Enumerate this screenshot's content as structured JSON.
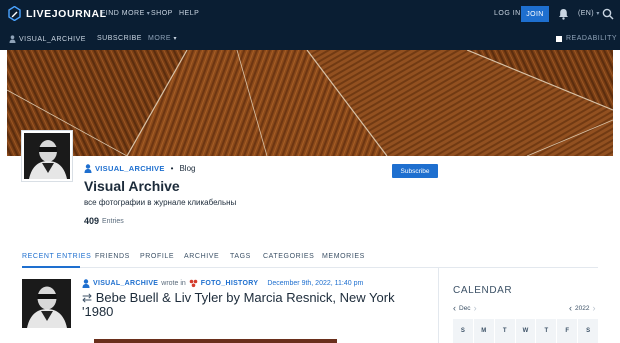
{
  "header": {
    "logo_text": "LIVEJOURNAL",
    "nav": [
      {
        "label": "FIND MORE",
        "has_dropdown": true
      },
      {
        "label": "SHOP",
        "has_dropdown": false
      },
      {
        "label": "HELP",
        "has_dropdown": false
      }
    ],
    "login_label": "LOG IN",
    "join_label": "JOIN",
    "language_label": "(EN)"
  },
  "subbar": {
    "username": "VISUAL_ARCHIVE",
    "subscribe_label": "SUBSCRIBE",
    "more_label": "MORE",
    "readability_label": "READABILITY"
  },
  "profile": {
    "username": "VISUAL_ARCHIVE",
    "kind": "Blog",
    "subscribe_button": "Subscribe",
    "title": "Visual Archive",
    "description": "все фотографии в журнале кликабельны",
    "entries_count": "409",
    "entries_label": "Entries"
  },
  "tabs": [
    {
      "label": "RECENT ENTRIES",
      "active": true
    },
    {
      "label": "FRIENDS",
      "active": false
    },
    {
      "label": "PROFILE",
      "active": false
    },
    {
      "label": "ARCHIVE",
      "active": false
    },
    {
      "label": "TAGS",
      "active": false
    },
    {
      "label": "CATEGORIES",
      "active": false
    },
    {
      "label": "MEMORIES",
      "active": false
    }
  ],
  "post": {
    "author": "VISUAL_ARCHIVE",
    "wrote_in": "wrote in",
    "community": "FOTO_HISTORY",
    "date": "December 9th, 2022, 11:40 pm",
    "title": "Bebe Buell & Liv Tyler by Marcia Resnick, New York '1980"
  },
  "calendar": {
    "title": "CALENDAR",
    "month": "Dec",
    "year": "2022",
    "weekdays": [
      "S",
      "M",
      "T",
      "W",
      "T",
      "F",
      "S"
    ]
  },
  "colors": {
    "nav_bg": "#0a1e33",
    "accent": "#1e6fcf",
    "text": "#1c2b3a"
  }
}
